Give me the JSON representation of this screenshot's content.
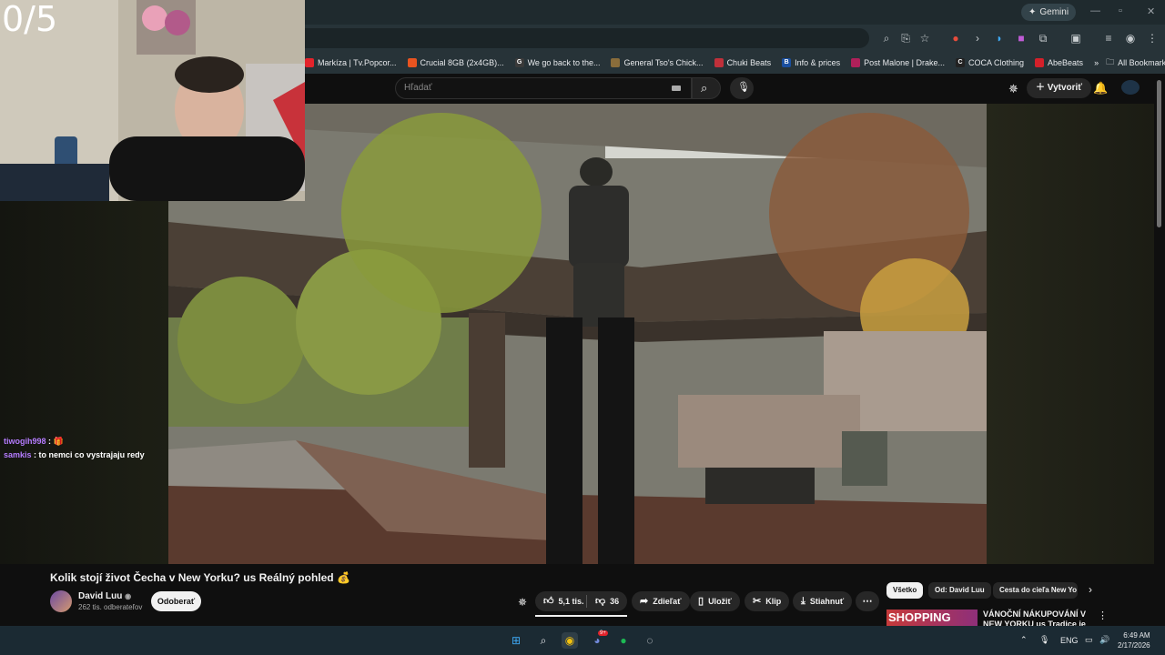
{
  "overlay": {
    "counter": "0/5"
  },
  "browser": {
    "gemini_label": "Gemini",
    "bookmarks": [
      {
        "label": "Markíza | Tv.Popcor...",
        "color": "#e4232b"
      },
      {
        "label": "Crucial 8GB (2x4GB)...",
        "color": "#e95420"
      },
      {
        "label": "We go back to the...",
        "color": "#3a3a3a"
      },
      {
        "label": "General Tso's Chick...",
        "color": "#8a6d3b"
      },
      {
        "label": "Chuki Beats",
        "color": "#c0303a"
      },
      {
        "label": "Info & prices",
        "color": "#1a4fa0"
      },
      {
        "label": "Post Malone | Drake...",
        "color": "#b0205a"
      },
      {
        "label": "COCA Clothing",
        "color": "#222222"
      },
      {
        "label": "AbeBeats",
        "color": "#d4202a"
      }
    ],
    "all_bookmarks": "All Bookmarks"
  },
  "youtube": {
    "search_placeholder": "Hľadať",
    "create_label": "Vytvoriť",
    "video_title": "Kolik stojí život Čecha v New Yorku? us Reálný pohled 💰",
    "channel_name": "David Luu",
    "subscribers": "262 tis. odberateľov",
    "subscribe_label": "Odoberať",
    "likes": "5,1 tis.",
    "dislikes": "36",
    "share_label": "Zdieľať",
    "save_label": "Uložiť",
    "clip_label": "Klip",
    "download_label": "Stiahnuť",
    "chips": [
      "Všetko",
      "Od: David Luu",
      "Cesta do cieľa New Yo"
    ],
    "recommended": {
      "thumb_text": "SHOPPING",
      "title": "VÁNOČNÍ NÁKUPOVÁNÍ V NEW YORKU us Tradice je tradice"
    }
  },
  "chat": [
    {
      "user": "tiwogih998",
      "message": "🎁"
    },
    {
      "user": "samkis",
      "message": "to nemci co vystrajaju redy"
    }
  ],
  "taskbar": {
    "language": "ENG",
    "time": "6:49 AM",
    "date": "2/17/2026",
    "discord_badge": "9+"
  }
}
